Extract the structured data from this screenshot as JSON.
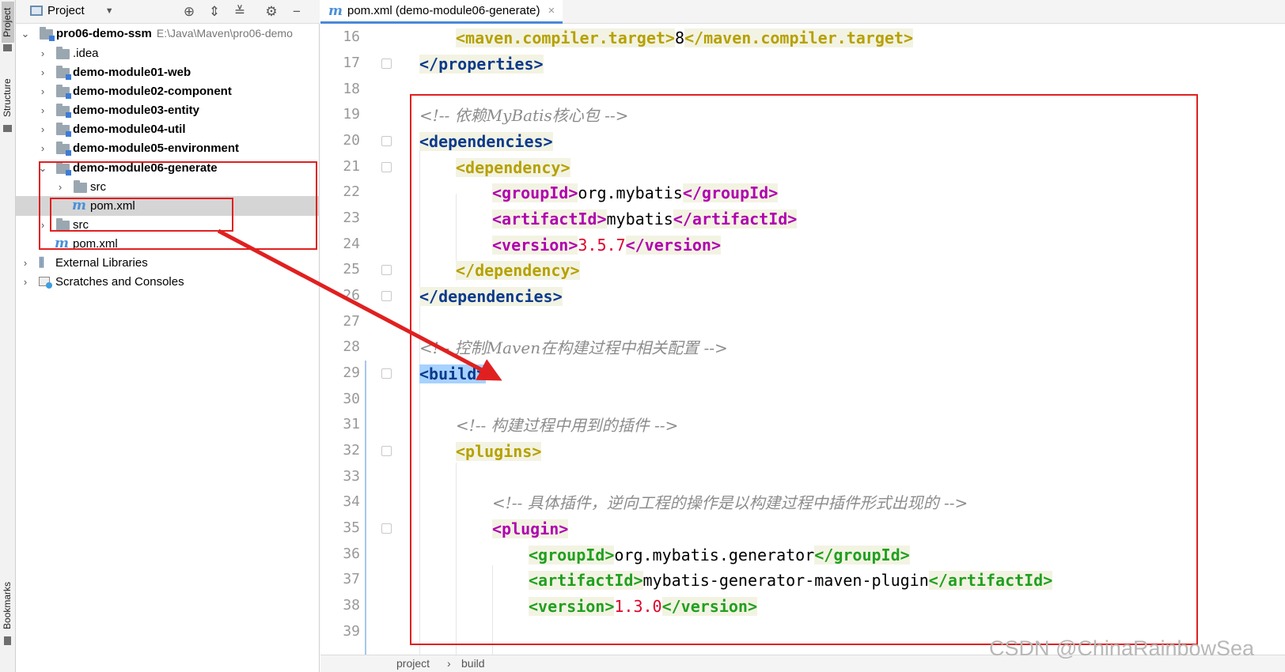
{
  "toolstrip": {
    "project_tab": "Project",
    "structure_tab": "Structure",
    "bookmarks_tab": "Bookmarks"
  },
  "project_panel": {
    "title": "Project",
    "tree": {
      "root": {
        "label": "pro06-demo-ssm",
        "path": "E:\\Java\\Maven\\pro06-demo"
      },
      "idea": ".idea",
      "m1": "demo-module01-web",
      "m2": "demo-module02-component",
      "m3": "demo-module03-entity",
      "m4": "demo-module04-util",
      "m5": "demo-module05-environment",
      "m6": "demo-module06-generate",
      "m6_src": "src",
      "m6_pom": "pom.xml",
      "src": "src",
      "pom": "pom.xml",
      "ext_libs": "External Libraries",
      "scratches": "Scratches and Consoles"
    }
  },
  "editor": {
    "tab_label": "pom.xml (demo-module06-generate)",
    "tab_close": "×",
    "lines": {
      "l16": {
        "num": "16",
        "open": "<maven.compiler.target>",
        "text": "8",
        "close": "</maven.compiler.target>"
      },
      "l17": {
        "num": "17",
        "close": "</properties>"
      },
      "l18": {
        "num": "18"
      },
      "l19": {
        "num": "19",
        "comment": "<!-- 依赖MyBatis核心包 -->"
      },
      "l20": {
        "num": "20",
        "open": "<dependencies>"
      },
      "l21": {
        "num": "21",
        "open": "<dependency>"
      },
      "l22": {
        "num": "22",
        "open": "<groupId>",
        "text": "org.mybatis",
        "close": "</groupId>"
      },
      "l23": {
        "num": "23",
        "open": "<artifactId>",
        "text": "mybatis",
        "close": "</artifactId>"
      },
      "l24": {
        "num": "24",
        "open": "<version>",
        "text": "3.5.7",
        "close": "</version>"
      },
      "l25": {
        "num": "25",
        "close": "</dependency>"
      },
      "l26": {
        "num": "26",
        "close": "</dependencies>"
      },
      "l27": {
        "num": "27"
      },
      "l28": {
        "num": "28",
        "comment": "<!-- 控制Maven在构建过程中相关配置 -->"
      },
      "l29": {
        "num": "29",
        "open": "<build>"
      },
      "l30": {
        "num": "30"
      },
      "l31": {
        "num": "31",
        "comment": "<!-- 构建过程中用到的插件 -->"
      },
      "l32": {
        "num": "32",
        "open": "<plugins>"
      },
      "l33": {
        "num": "33"
      },
      "l34": {
        "num": "34",
        "comment": "<!-- 具体插件，逆向工程的操作是以构建过程中插件形式出现的 -->"
      },
      "l35": {
        "num": "35",
        "open": "<plugin>"
      },
      "l36": {
        "num": "36",
        "open": "<groupId>",
        "text": "org.mybatis.generator",
        "close": "</groupId>"
      },
      "l37": {
        "num": "37",
        "open": "<artifactId>",
        "text": "mybatis-generator-maven-plugin",
        "close": "</artifactId>"
      },
      "l38": {
        "num": "38",
        "open": "<version>",
        "text": "1.3.0",
        "close": "</version>"
      },
      "l39": {
        "num": "39"
      }
    },
    "breadcrumb": {
      "project": "project",
      "sep": "›",
      "build": "build"
    }
  },
  "watermark": "CSDN @ChinaRainbowSea",
  "colors": {
    "annotation_red": "#e02020",
    "tab_underline": "#4a88d8",
    "highlight": "#a6d2ff"
  }
}
